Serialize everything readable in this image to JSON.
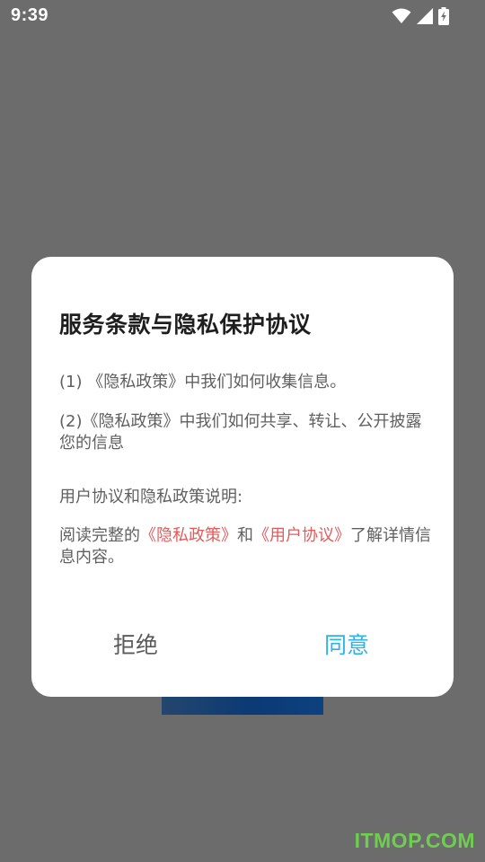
{
  "status_bar": {
    "time": "9:39",
    "icons": [
      "wifi-icon",
      "signal-icon",
      "battery-charging-icon"
    ]
  },
  "dialog": {
    "title": "服务条款与隐私保护协议",
    "item1": "(1) 《隐私政策》中我们如何收集信息。",
    "item2": "(2)《隐私政策》中我们如何共享、转让、公开披露您的信息",
    "section_label": "用户协议和隐私政策说明:",
    "read_prefix": "阅读完整的",
    "privacy_link": "《隐私政策》",
    "and_text": "和",
    "user_agreement_link": "《用户协议》",
    "read_suffix": "了解详情信息内容。",
    "reject_label": "拒绝",
    "agree_label": "同意"
  },
  "watermark": "ITMOP.COM",
  "colors": {
    "overlay": "#6c6c6c",
    "link": "#e35b5b",
    "agree": "#2bb3ea",
    "watermark": "#6fd94c"
  }
}
